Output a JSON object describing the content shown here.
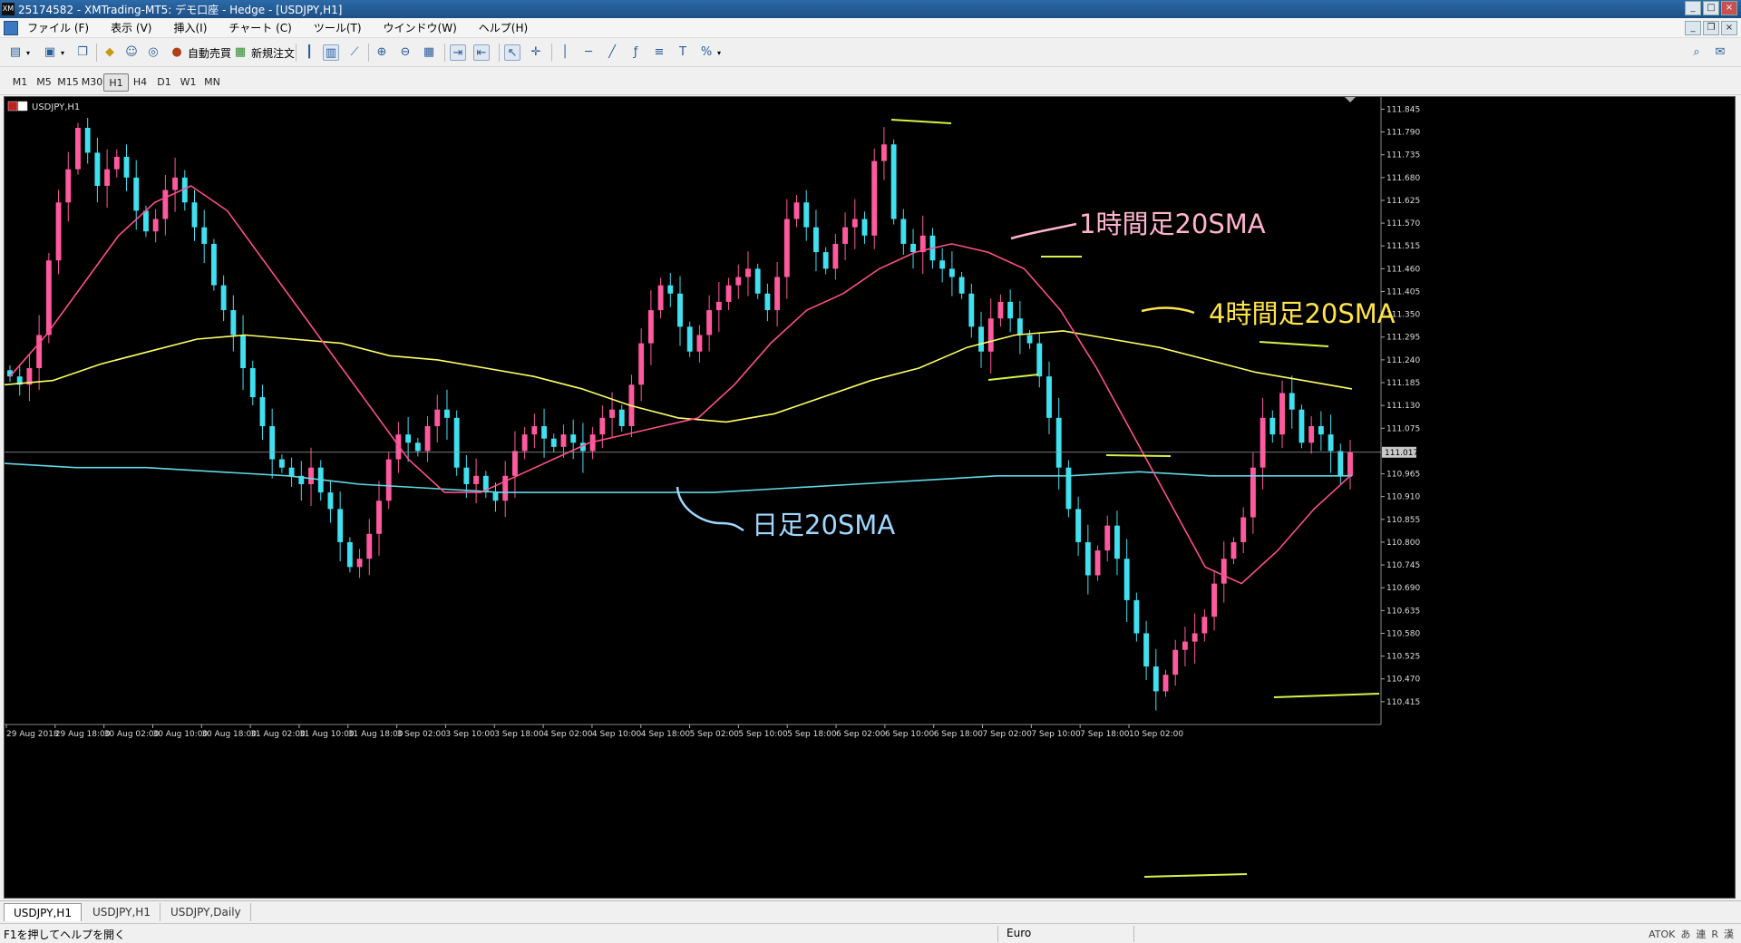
{
  "window": {
    "title": "25174582 - XMTrading-MT5: デモ口座 - Hedge - [USDJPY,H1]",
    "logo_text": "XM"
  },
  "menu": [
    "ファイル (F)",
    "表示 (V)",
    "挿入(I)",
    "チャート (C)",
    "ツール(T)",
    "ウインドウ(W)",
    "ヘルプ(H)"
  ],
  "toolbar": {
    "auto_trade_label": "自動売買",
    "new_order_label": "新規注文"
  },
  "timeframes": [
    "M1",
    "M5",
    "M15",
    "M30",
    "H1",
    "H4",
    "D1",
    "W1",
    "MN"
  ],
  "active_timeframe": "H1",
  "chart": {
    "symbol_label": "USDJPY,H1",
    "current_price_label": "111.017",
    "price_axis_labels": [
      "111.845",
      "111.790",
      "111.735",
      "111.680",
      "111.625",
      "111.570",
      "111.515",
      "111.460",
      "111.405",
      "111.350",
      "111.295",
      "111.240",
      "111.185",
      "111.130",
      "111.075",
      "110.965",
      "110.910",
      "110.855",
      "110.800",
      "110.745",
      "110.690",
      "110.635",
      "110.580",
      "110.525",
      "110.470",
      "110.415"
    ],
    "time_axis_labels": [
      "29 Aug 2018",
      "29 Aug 18:00",
      "30 Aug 02:00",
      "30 Aug 10:00",
      "30 Aug 18:00",
      "31 Aug 02:00",
      "31 Aug 10:00",
      "31 Aug 18:00",
      "3 Sep 02:00",
      "3 Sep 10:00",
      "3 Sep 18:00",
      "4 Sep 02:00",
      "4 Sep 10:00",
      "4 Sep 18:00",
      "5 Sep 02:00",
      "5 Sep 10:00",
      "5 Sep 18:00",
      "6 Sep 02:00",
      "6 Sep 10:00",
      "6 Sep 18:00",
      "7 Sep 02:00",
      "7 Sep 10:00",
      "7 Sep 18:00",
      "10 Sep 02:00"
    ],
    "annotations": {
      "h1_sma": "1時間足20SMA",
      "h4_sma": "4時間足20SMA",
      "d1_sma": "日足20SMA"
    },
    "colors": {
      "background": "#000000",
      "bull": "#ff5a9e",
      "bear": "#3fe0f0",
      "sma_h1": "#ff4f8b",
      "sma_h4": "#ffff66",
      "sma_d1": "#5fd9e6",
      "note_h1": "#ffb3cf",
      "note_h4": "#ffe44a",
      "note_d1": "#9fd8ff",
      "sr_line": "#d9f24a"
    }
  },
  "chart_data": {
    "type": "candlestick",
    "title": "USDJPY,H1",
    "ylim": [
      110.36,
      111.87
    ],
    "current_price": 111.017,
    "y_ticks": [
      111.845,
      111.79,
      111.735,
      111.68,
      111.625,
      111.57,
      111.515,
      111.46,
      111.405,
      111.35,
      111.295,
      111.24,
      111.185,
      111.13,
      111.075,
      110.965,
      110.91,
      110.855,
      110.8,
      110.745,
      110.69,
      110.635,
      110.58,
      110.525,
      110.47,
      110.415
    ],
    "x_ticks": [
      "29 Aug 2018",
      "29 Aug 18:00",
      "30 Aug 02:00",
      "30 Aug 10:00",
      "30 Aug 18:00",
      "31 Aug 02:00",
      "31 Aug 10:00",
      "31 Aug 18:00",
      "3 Sep 02:00",
      "3 Sep 10:00",
      "3 Sep 18:00",
      "4 Sep 02:00",
      "4 Sep 10:00",
      "4 Sep 18:00",
      "5 Sep 02:00",
      "5 Sep 10:00",
      "5 Sep 18:00",
      "6 Sep 02:00",
      "6 Sep 10:00",
      "6 Sep 18:00",
      "7 Sep 02:00",
      "7 Sep 10:00",
      "7 Sep 18:00",
      "10 Sep 02:00"
    ],
    "close_path": [
      111.2,
      111.18,
      111.22,
      111.3,
      111.48,
      111.62,
      111.7,
      111.8,
      111.74,
      111.66,
      111.7,
      111.73,
      111.68,
      111.6,
      111.55,
      111.58,
      111.65,
      111.68,
      111.62,
      111.56,
      111.52,
      111.42,
      111.36,
      111.3,
      111.22,
      111.15,
      111.08,
      111.0,
      110.98,
      110.96,
      110.94,
      110.98,
      110.92,
      110.88,
      110.8,
      110.74,
      110.76,
      110.82,
      110.9,
      111.0,
      111.06,
      111.04,
      111.02,
      111.08,
      111.12,
      111.1,
      110.98,
      110.94,
      110.96,
      110.92,
      110.9,
      110.96,
      111.02,
      111.06,
      111.08,
      111.05,
      111.03,
      111.06,
      111.04,
      111.02,
      111.06,
      111.1,
      111.12,
      111.08,
      111.18,
      111.28,
      111.36,
      111.42,
      111.4,
      111.32,
      111.26,
      111.3,
      111.36,
      111.38,
      111.42,
      111.44,
      111.46,
      111.4,
      111.36,
      111.44,
      111.58,
      111.62,
      111.56,
      111.5,
      111.46,
      111.52,
      111.56,
      111.58,
      111.54,
      111.72,
      111.76,
      111.58,
      111.52,
      111.5,
      111.54,
      111.48,
      111.46,
      111.44,
      111.4,
      111.32,
      111.26,
      111.34,
      111.38,
      111.34,
      111.3,
      111.28,
      111.2,
      111.1,
      110.98,
      110.88,
      110.8,
      110.72,
      110.78,
      110.84,
      110.76,
      110.66,
      110.58,
      110.5,
      110.44,
      110.48,
      110.54,
      110.56,
      110.58,
      110.62,
      110.7,
      110.76,
      110.8,
      110.86,
      110.98,
      111.1,
      111.06,
      111.16,
      111.12,
      111.04,
      111.08,
      111.06,
      111.02,
      110.96,
      111.017
    ],
    "series": [
      {
        "name": "1時間足20SMA",
        "values": [
          111.2,
          111.3,
          111.42,
          111.54,
          111.62,
          111.66,
          111.6,
          111.48,
          111.36,
          111.24,
          111.12,
          111.0,
          110.92,
          110.92,
          110.96,
          111.0,
          111.04,
          111.06,
          111.08,
          111.1,
          111.18,
          111.28,
          111.36,
          111.4,
          111.46,
          111.5,
          111.52,
          111.5,
          111.46,
          111.36,
          111.22,
          111.06,
          110.9,
          110.74,
          110.7,
          110.78,
          110.88,
          110.96
        ]
      },
      {
        "name": "4時間足20SMA",
        "values": [
          111.18,
          111.19,
          111.23,
          111.26,
          111.29,
          111.3,
          111.29,
          111.28,
          111.25,
          111.24,
          111.22,
          111.2,
          111.17,
          111.13,
          111.1,
          111.09,
          111.11,
          111.15,
          111.19,
          111.22,
          111.27,
          111.3,
          111.31,
          111.29,
          111.27,
          111.24,
          111.21,
          111.19,
          111.17
        ]
      },
      {
        "name": "日足20SMA",
        "values": [
          110.99,
          110.98,
          110.98,
          110.97,
          110.96,
          110.94,
          110.93,
          110.92,
          110.92,
          110.92,
          110.92,
          110.93,
          110.94,
          110.95,
          110.96,
          110.96,
          110.97,
          110.96,
          110.96,
          110.96
        ]
      }
    ]
  },
  "tabs": [
    "USDJPY,H1",
    "USDJPY,H1",
    "USDJPY,Daily"
  ],
  "status": {
    "help_text": "F1を押してヘルプを開く",
    "profile": "Euro",
    "ime_items": [
      "ATOK",
      "あ",
      "連",
      "R",
      "漢"
    ]
  }
}
